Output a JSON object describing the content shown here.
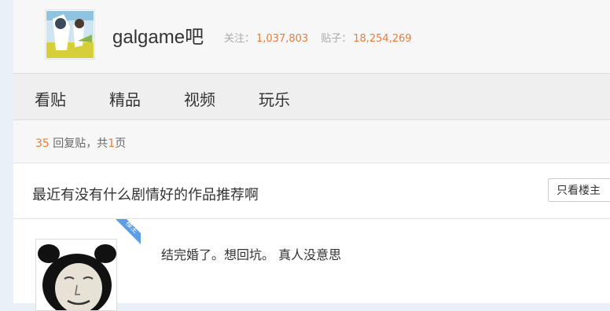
{
  "forum": {
    "name": "galgame吧",
    "follow_label": "关注：",
    "follow_count": "1,037,803",
    "posts_label": "贴子：",
    "posts_count": "18,254,269"
  },
  "nav": {
    "items": [
      {
        "label": "看贴"
      },
      {
        "label": "精品"
      },
      {
        "label": "视频"
      },
      {
        "label": "玩乐"
      }
    ]
  },
  "thread": {
    "reply_count": "35",
    "reply_text": "回复贴，共",
    "page_count": "1",
    "page_unit": "页",
    "title": "最近有没有什么剧情好的作品推荐啊",
    "only_op_label": "只看楼主"
  },
  "post": {
    "op_badge": "楼主",
    "content": "结完婚了。想回坑。 真人没意思"
  },
  "colors": {
    "accent": "#e97b38",
    "badge": "#5b9de6"
  }
}
